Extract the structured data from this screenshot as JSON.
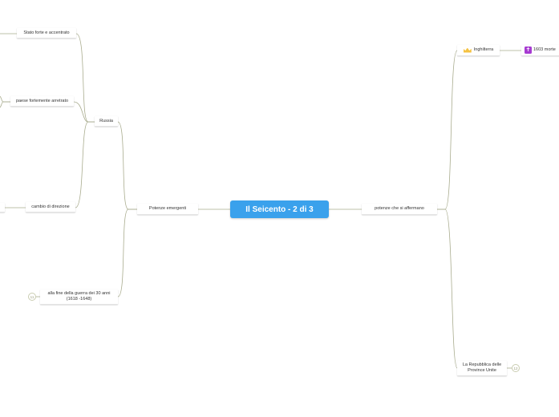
{
  "central": {
    "title": "Il Seicento - 2 di 3"
  },
  "left": {
    "potenze_emergenti": "Potenze emergenti",
    "russia": "Russia",
    "stato_forte": "Stato forte e accentrato",
    "paese_arretrato": "paese fortemente arretrato",
    "cambio_direzione": "cambio di direzione",
    "fine_guerra": "alla fine della guerra dei 30 anni (1618 -1648)",
    "fine_guerra_badge": "11"
  },
  "right": {
    "potenze_affermano": "potenze che si affermano",
    "inghilterra": "Inghilterra",
    "inghilterra_icon": "crown-icon",
    "morte_label": "1603 morte",
    "morte_icon": "latin-cross-icon",
    "repubblica": "La Repubblica delle Province Unite",
    "repubblica_badge": "12"
  },
  "colors": {
    "central_bg": "#3aa1ec",
    "connector": "#a9ac8e"
  }
}
